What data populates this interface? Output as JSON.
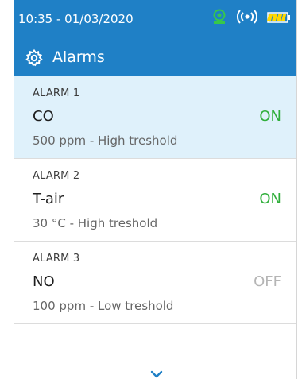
{
  "status": {
    "datetime": "10:35 - 01/03/2020",
    "icons": [
      "sensor-status-icon",
      "wireless-signal-icon",
      "battery-icon"
    ]
  },
  "colors": {
    "header": "#1f80c6",
    "selected_row": "#dff1fb",
    "state_on": "#2fae3a",
    "state_off": "#b5b5b5",
    "sensor_icon": "#37c84a",
    "battery": "#ffd800"
  },
  "title": {
    "icon": "gear-icon",
    "text": "Alarms"
  },
  "alarms": [
    {
      "name": "ALARM 1",
      "gas": "CO",
      "state": "ON",
      "description": "500 ppm - High treshold",
      "selected": true
    },
    {
      "name": "ALARM 2",
      "gas": "T-air",
      "state": "ON",
      "description": "30 °C - High treshold",
      "selected": false
    },
    {
      "name": "ALARM 3",
      "gas": "NO",
      "state": "OFF",
      "description": "100 ppm - Low treshold",
      "selected": false
    }
  ],
  "scroll": {
    "icon": "chevron-down-icon"
  }
}
